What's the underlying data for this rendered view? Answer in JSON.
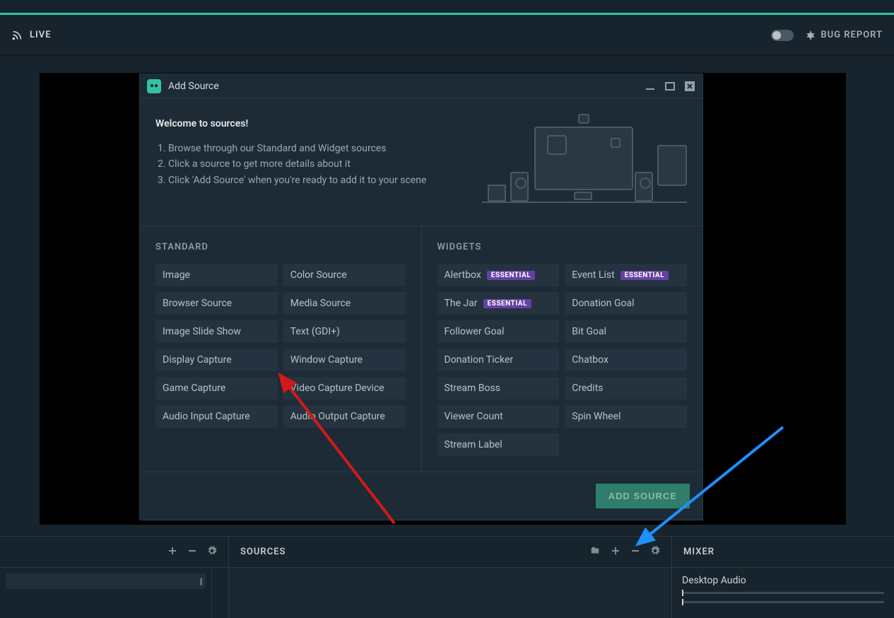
{
  "topbar": {
    "live_label": "LIVE",
    "bug_report_label": "BUG REPORT"
  },
  "dialog": {
    "title": "Add Source",
    "welcome_heading": "Welcome to sources!",
    "instructions": [
      "Browse through our Standard and Widget sources",
      "Click a source to get more details about it",
      "Click 'Add Source' when you're ready to add it to your scene"
    ],
    "standard_heading": "STANDARD",
    "widgets_heading": "WIDGETS",
    "standard_sources": [
      "Image",
      "Color Source",
      "Browser Source",
      "Media Source",
      "Image Slide Show",
      "Text (GDI+)",
      "Display Capture",
      "Window Capture",
      "Game Capture",
      "Video Capture Device",
      "Audio Input Capture",
      "Audio Output Capture"
    ],
    "widget_sources": [
      {
        "label": "Alertbox",
        "badge": "ESSENTIAL"
      },
      {
        "label": "Event List",
        "badge": "ESSENTIAL"
      },
      {
        "label": "The Jar",
        "badge": "ESSENTIAL"
      },
      {
        "label": "Donation Goal"
      },
      {
        "label": "Follower Goal"
      },
      {
        "label": "Bit Goal"
      },
      {
        "label": "Donation Ticker"
      },
      {
        "label": "Chatbox"
      },
      {
        "label": "Stream Boss"
      },
      {
        "label": "Credits"
      },
      {
        "label": "Viewer Count"
      },
      {
        "label": "Spin Wheel"
      },
      {
        "label": "Stream Label"
      }
    ],
    "add_button_label": "ADD SOURCE"
  },
  "panels": {
    "sources_label": "SOURCES",
    "mixer_label": "MIXER",
    "mixer_item": "Desktop Audio"
  },
  "colors": {
    "accent": "#31c3a2",
    "badge_bg": "#6441a5",
    "arrow_red": "#d11919",
    "arrow_blue": "#1e90ff"
  }
}
